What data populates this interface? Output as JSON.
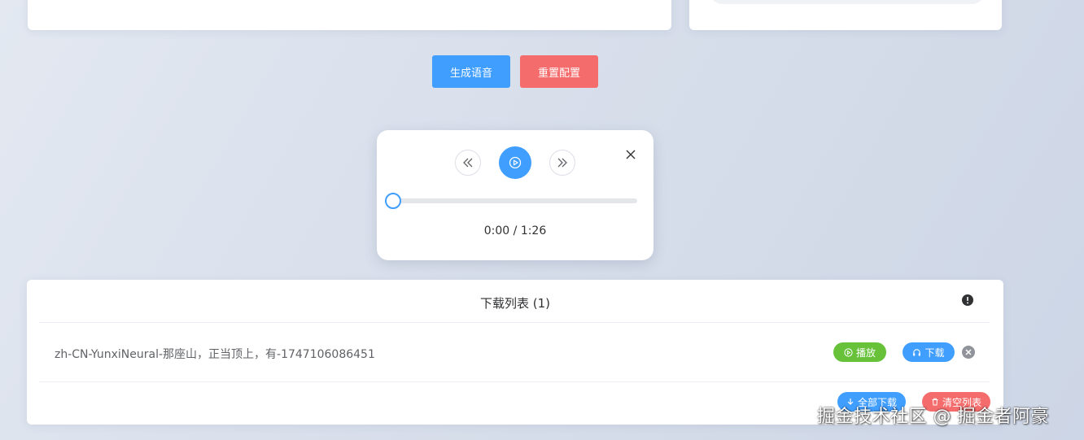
{
  "actions": {
    "generate_label": "生成语音",
    "reset_label": "重置配置"
  },
  "player": {
    "current_time": "0:00",
    "separator": " / ",
    "duration": "1:26",
    "progress_fraction": 0
  },
  "download_list": {
    "title": "下载列表 (1)",
    "items": [
      {
        "name": "zh-CN-YunxiNeural-那座山，正当顶上，有-1747106086451",
        "play_label": "播放",
        "download_label": "下载"
      }
    ],
    "download_all_label": "全部下载",
    "clear_label": "清空列表"
  },
  "watermark": "掘金技术社区 @ 掘金者阿豪",
  "colors": {
    "primary": "#409eff",
    "danger": "#f56c6c",
    "success": "#67c23a",
    "muted": "#909399"
  },
  "icons": {
    "prev": "double-chevron-left-icon",
    "play": "play-circle-icon",
    "next": "double-chevron-right-icon",
    "close": "close-icon",
    "info": "info-icon",
    "headset": "headset-icon",
    "download": "download-arrow-icon",
    "trash": "trash-icon",
    "remove": "remove-circle-icon"
  }
}
